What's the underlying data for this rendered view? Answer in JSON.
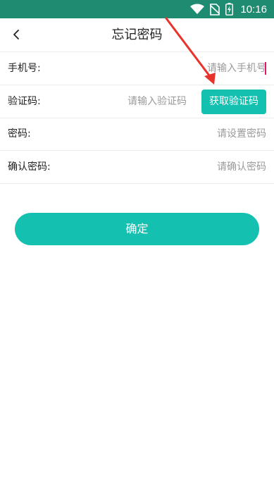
{
  "status_bar": {
    "time": "10:16",
    "icons": [
      "wifi-icon",
      "no-sim-icon",
      "battery-charging-icon"
    ]
  },
  "header": {
    "title": "忘记密码",
    "back_icon": "chevron-left-icon"
  },
  "form": {
    "phone": {
      "label": "手机号:",
      "placeholder": "请输入手机号"
    },
    "code": {
      "label": "验证码:",
      "placeholder": "请输入验证码",
      "button_label": "获取验证码"
    },
    "password": {
      "label": "密码:",
      "placeholder": "请设置密码"
    },
    "confirm_password": {
      "label": "确认密码:",
      "placeholder": "请确认密码"
    }
  },
  "confirm_button_label": "确定",
  "colors": {
    "status_bar": "#1f8c72",
    "accent": "#14c1b1",
    "annotation_arrow": "#e8322c",
    "cursor": "#e2186b"
  },
  "annotation": "red-arrow-icon"
}
